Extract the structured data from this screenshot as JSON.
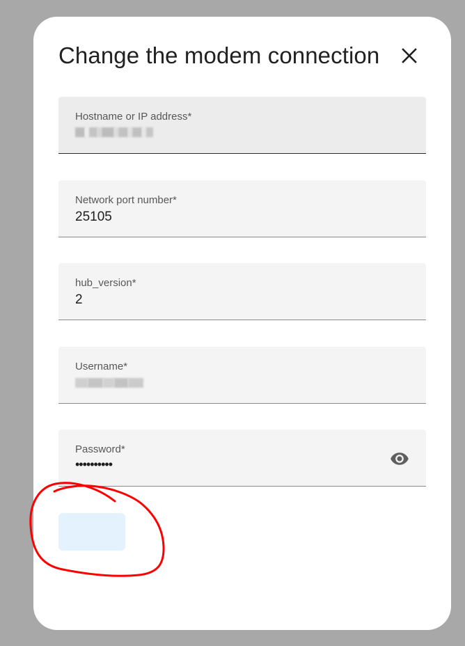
{
  "dialog": {
    "title": "Change the modem connection",
    "close_icon": "close-icon"
  },
  "fields": {
    "host": {
      "label": "Hostname or IP address*",
      "value_state": "redacted"
    },
    "port": {
      "label": "Network port number*",
      "value": "25105"
    },
    "hub_version": {
      "label": "hub_version*",
      "value": "2"
    },
    "username": {
      "label": "Username*",
      "value_state": "redacted"
    },
    "password": {
      "label": "Password*",
      "value": "••••••••••",
      "toggle_icon": "eye-icon"
    }
  },
  "submit_button": {
    "label": "",
    "background": "#e3f2fd"
  },
  "annotation": {
    "color": "#ff0000",
    "shape": "hand-drawn circle around submit button"
  },
  "colors": {
    "overlay": "#a8a8a8",
    "dialog": "#ffffff",
    "field": "#f4f4f4"
  }
}
